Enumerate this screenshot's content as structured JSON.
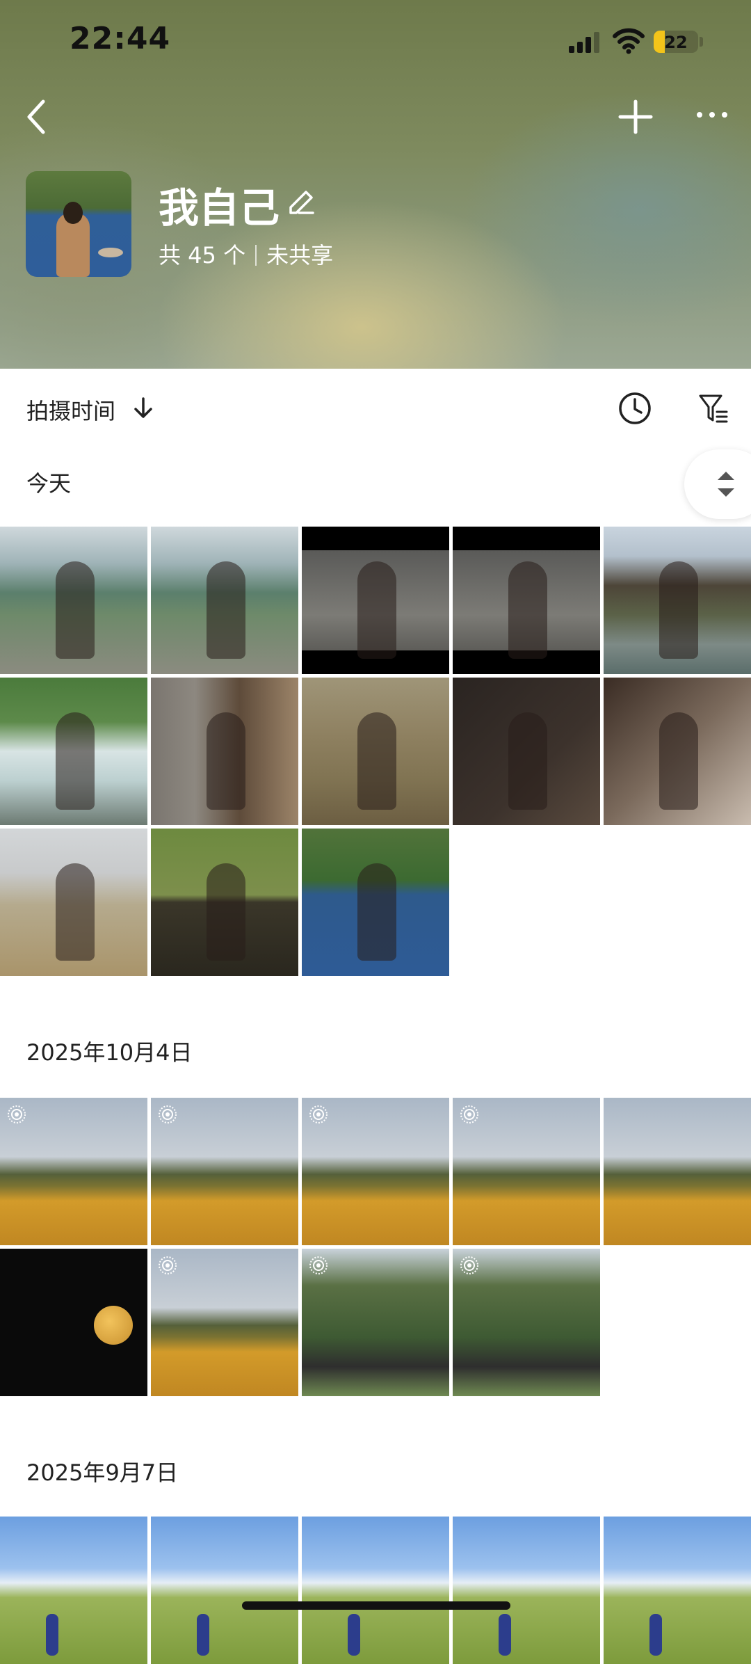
{
  "status_bar": {
    "time": "22:44",
    "battery": "22"
  },
  "album": {
    "title": "我自己",
    "count_text": "共 45 个",
    "share_status": "未共享"
  },
  "sort": {
    "label": "拍摄时间"
  },
  "sections": [
    {
      "date": "今天",
      "photos": [
        {
          "scene": "sea",
          "live": false
        },
        {
          "scene": "sea",
          "live": false
        },
        {
          "scene": "street",
          "live": false
        },
        {
          "scene": "street",
          "live": false
        },
        {
          "scene": "town",
          "live": false
        },
        {
          "scene": "water",
          "live": false
        },
        {
          "scene": "room",
          "live": false
        },
        {
          "scene": "field",
          "live": false
        },
        {
          "scene": "dark",
          "live": false
        },
        {
          "scene": "close",
          "live": false
        },
        {
          "scene": "wheat",
          "live": false
        },
        {
          "scene": "grass",
          "live": false
        },
        {
          "scene": "lake",
          "live": false
        }
      ]
    },
    {
      "date": "2025年10月4日",
      "photos": [
        {
          "scene": "flower",
          "live": true
        },
        {
          "scene": "flower",
          "live": true
        },
        {
          "scene": "flower",
          "live": true
        },
        {
          "scene": "flower",
          "live": true
        },
        {
          "scene": "flower",
          "live": false
        },
        {
          "scene": "moon",
          "live": false
        },
        {
          "scene": "flower",
          "live": true
        },
        {
          "scene": "forest",
          "live": true
        },
        {
          "scene": "forest",
          "live": true
        }
      ]
    },
    {
      "date": "2025年9月7日",
      "photos": [
        {
          "scene": "hill",
          "live": false
        },
        {
          "scene": "hill",
          "live": false
        },
        {
          "scene": "hill",
          "live": false
        },
        {
          "scene": "hill",
          "live": false
        },
        {
          "scene": "hill",
          "live": false
        }
      ]
    }
  ],
  "icons": {
    "back": "chevron-left-icon",
    "add": "plus-icon",
    "more": "ellipsis-icon",
    "edit": "edit-icon",
    "sort_direction": "arrow-down-icon",
    "clock": "clock-icon",
    "filter": "filter-icon",
    "live_photo": "live-photo-icon",
    "scroll": "scroll-handle-icon"
  },
  "colors": {
    "battery_accent": "#f3c41a"
  }
}
